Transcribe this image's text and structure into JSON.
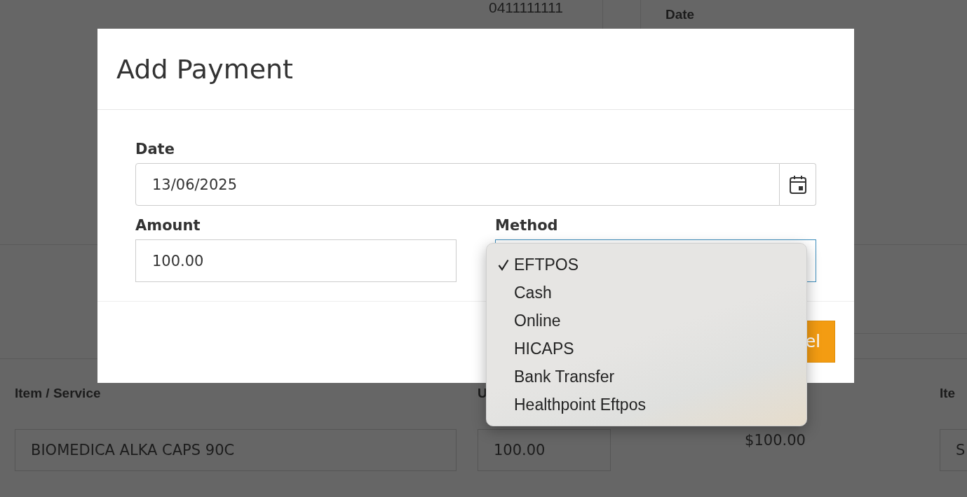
{
  "background": {
    "phone": "0411111111",
    "date_header": "Date",
    "columns": [
      "Item / Service",
      "U",
      "Ite"
    ],
    "row": {
      "item": "BIOMEDICA ALKA CAPS 90C",
      "column_2": "100.00",
      "column_3": "$100.00",
      "column_4": "S"
    }
  },
  "dialog": {
    "title": "Add Payment",
    "fields": [
      {
        "kind": "date",
        "label": "Date",
        "value": "13/06/2025",
        "focused": false
      },
      {
        "kind": "text",
        "label": "Amount",
        "value": "100.00",
        "focused": false
      },
      {
        "kind": "select",
        "label": "Method",
        "focused": true
      }
    ],
    "button": "el"
  },
  "menu": {
    "options": [
      {
        "label": "EFTPOS",
        "selected": true
      },
      {
        "label": "Cash",
        "selected": false
      },
      {
        "label": "Online",
        "selected": false
      },
      {
        "label": "HICAPS",
        "selected": false
      },
      {
        "label": "Bank Transfer",
        "selected": false
      },
      {
        "label": "Healthpoint Eftpos",
        "selected": false
      }
    ]
  }
}
